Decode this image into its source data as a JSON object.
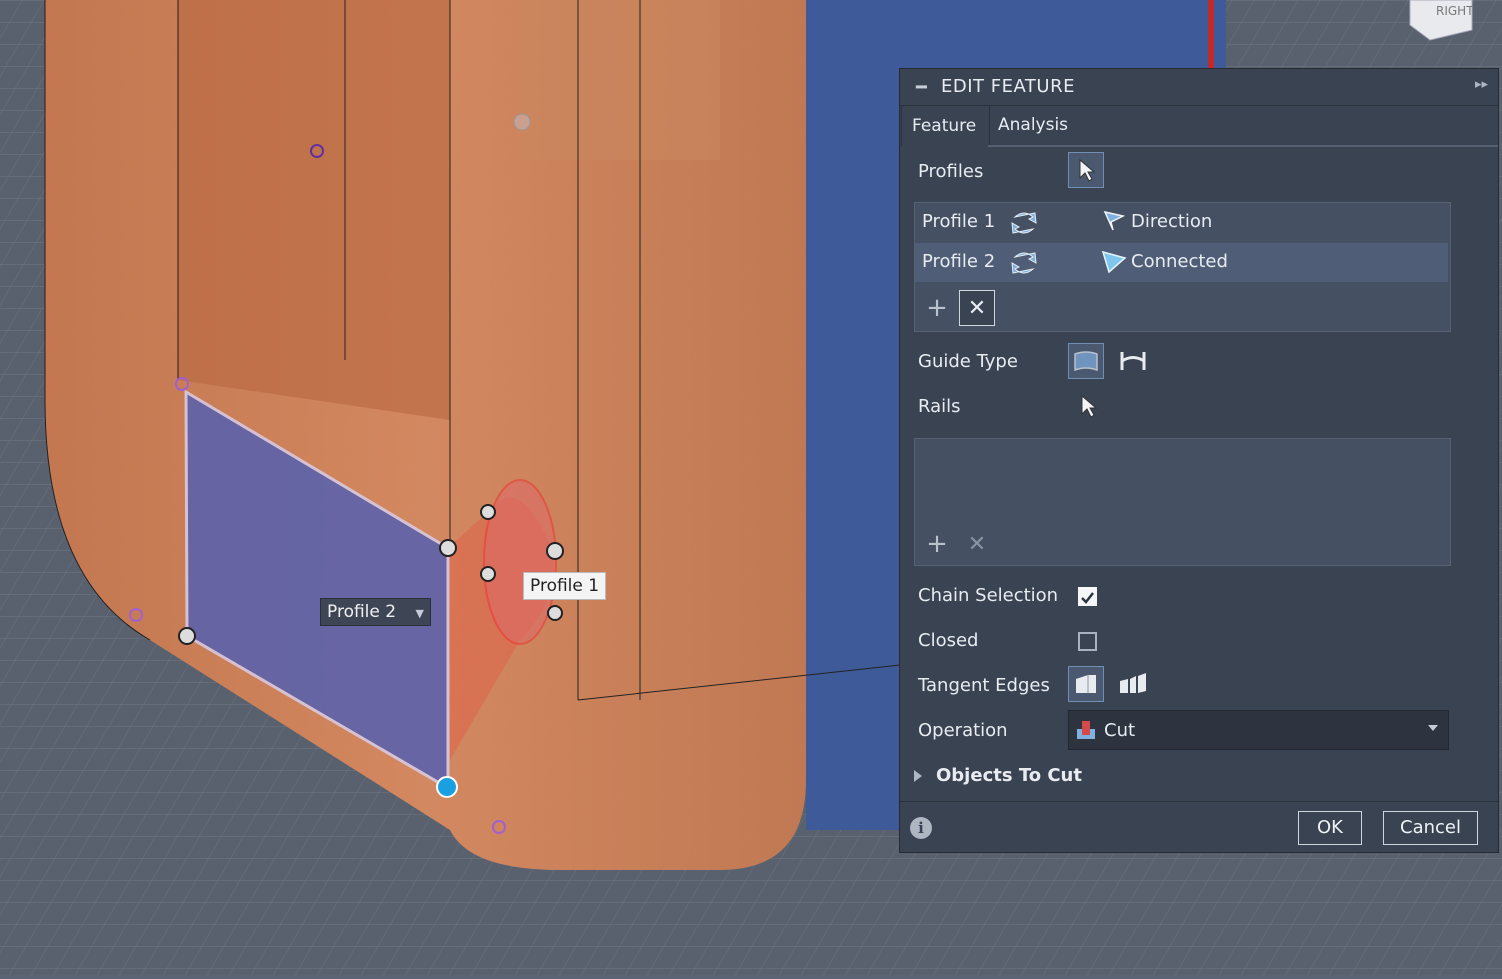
{
  "viewport": {
    "label_profile2": "Profile 2",
    "label_profile1": "Profile 1",
    "viewcube_face": "RIGHT"
  },
  "panel": {
    "title": "EDIT FEATURE",
    "tabs": [
      {
        "label": "Feature",
        "active": true
      },
      {
        "label": "Analysis",
        "active": false
      }
    ],
    "profiles_label": "Profiles",
    "profiles": [
      {
        "name": "Profile 1",
        "condition": "Direction",
        "selected": false
      },
      {
        "name": "Profile 2",
        "condition": "Connected",
        "selected": true
      }
    ],
    "guide_type_label": "Guide Type",
    "rails_label": "Rails",
    "chain_selection_label": "Chain Selection",
    "chain_selection_checked": true,
    "closed_label": "Closed",
    "closed_checked": false,
    "tangent_edges_label": "Tangent Edges",
    "operation_label": "Operation",
    "operation_value": "Cut",
    "objects_to_cut_label": "Objects To Cut",
    "ok_label": "OK",
    "cancel_label": "Cancel"
  },
  "colors": {
    "panel_bg": "#3a4352",
    "listbox_bg": "#455063",
    "selected_row": "#4f5e76",
    "body_orange": "#d98a5f",
    "profile_blue": "#5560b0",
    "background_wall": "#3f5a99"
  }
}
